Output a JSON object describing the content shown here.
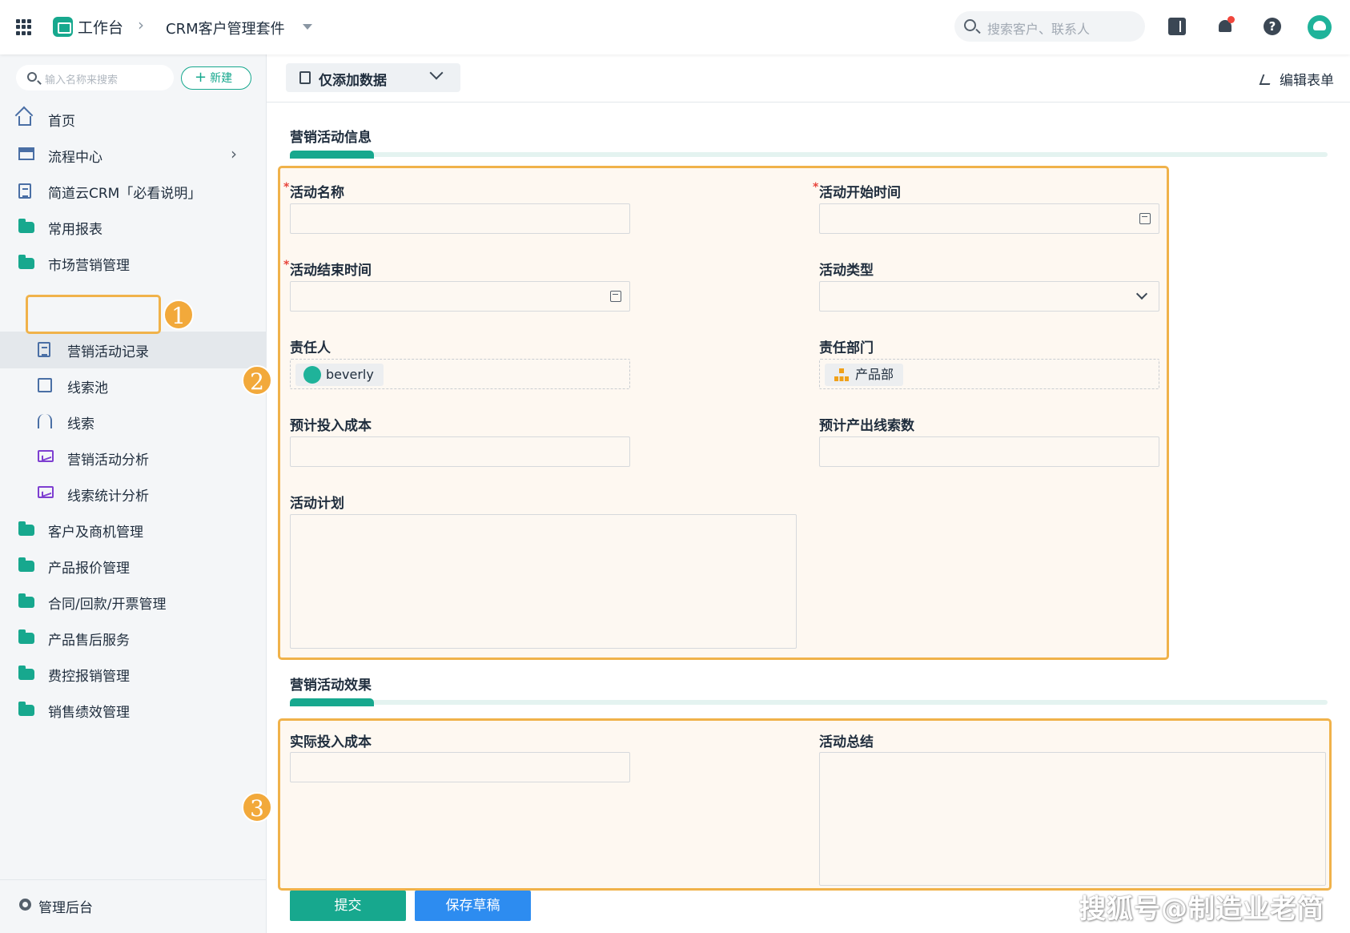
{
  "topbar": {
    "app_title": "工作台",
    "breadcrumb": "CRM客户管理套件",
    "search_placeholder": "搜索客户、联系人"
  },
  "sidebar": {
    "search_placeholder": "输入名称来搜索",
    "new_button": "新建",
    "items": [
      {
        "label": "首页"
      },
      {
        "label": "流程中心"
      },
      {
        "label": "简道云CRM「必看说明」"
      },
      {
        "label": "常用报表"
      },
      {
        "label": "市场营销管理"
      },
      {
        "label": "营销活动记录"
      },
      {
        "label": "线索池"
      },
      {
        "label": "线索"
      },
      {
        "label": "营销活动分析"
      },
      {
        "label": "线索统计分析"
      },
      {
        "label": "客户及商机管理"
      },
      {
        "label": "产品报价管理"
      },
      {
        "label": "合同/回款/开票管理"
      },
      {
        "label": "产品售后服务"
      },
      {
        "label": "费控报销管理"
      },
      {
        "label": "销售绩效管理"
      }
    ],
    "admin_label": "管理后台"
  },
  "toolbar": {
    "view_label": "仅添加数据",
    "edit_form_label": "编辑表单"
  },
  "form": {
    "section1_title": "营销活动信息",
    "section2_title": "营销活动效果",
    "fields": {
      "activity_name": "活动名称",
      "start_time": "活动开始时间",
      "end_time": "活动结束时间",
      "activity_type": "活动类型",
      "owner": "责任人",
      "owner_value": "beverly",
      "department": "责任部门",
      "department_value": "产品部",
      "planned_cost": "预计投入成本",
      "expected_leads": "预计产出线索数",
      "plan": "活动计划",
      "actual_cost": "实际投入成本",
      "summary": "活动总结"
    },
    "required_mark": "*"
  },
  "actions": {
    "submit": "提交",
    "save_draft": "保存草稿"
  },
  "markers": [
    "1",
    "2",
    "3"
  ],
  "watermark": "搜狐号@制造业老简",
  "colors": {
    "brand": "#17a88e",
    "highlight": "#f0b24a",
    "primary_blue": "#2d8cf0",
    "required": "#e8453c"
  }
}
